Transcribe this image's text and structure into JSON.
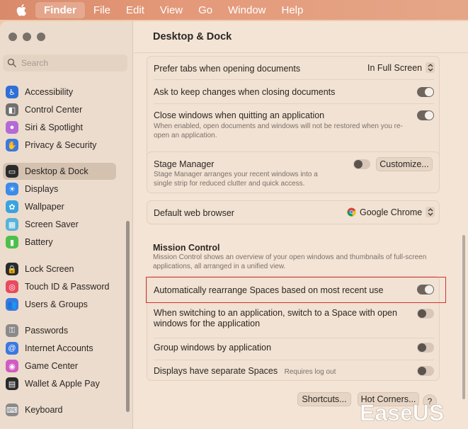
{
  "menubar": {
    "items": [
      "Finder",
      "File",
      "Edit",
      "View",
      "Go",
      "Window",
      "Help"
    ]
  },
  "sidebar": {
    "search_placeholder": "Search",
    "items": [
      {
        "label": "Accessibility",
        "icon": "accessibility-icon",
        "color": "#2f6fd6"
      },
      {
        "label": "Control Center",
        "icon": "control-center-icon",
        "color": "#707070"
      },
      {
        "label": "Siri & Spotlight",
        "icon": "siri-icon",
        "color": "#b46ad6"
      },
      {
        "label": "Privacy & Security",
        "icon": "hand-icon",
        "color": "#3b78e0"
      },
      {
        "label": "Desktop & Dock",
        "icon": "desktop-dock-icon",
        "color": "#2a2a2a"
      },
      {
        "label": "Displays",
        "icon": "displays-icon",
        "color": "#3a8bea"
      },
      {
        "label": "Wallpaper",
        "icon": "wallpaper-icon",
        "color": "#39a4e0"
      },
      {
        "label": "Screen Saver",
        "icon": "screen-saver-icon",
        "color": "#56b3d8"
      },
      {
        "label": "Battery",
        "icon": "battery-icon",
        "color": "#4cc04a"
      },
      {
        "label": "Lock Screen",
        "icon": "lock-icon",
        "color": "#2a2a2a"
      },
      {
        "label": "Touch ID & Password",
        "icon": "fingerprint-icon",
        "color": "#e84a5f"
      },
      {
        "label": "Users & Groups",
        "icon": "users-icon",
        "color": "#3b78e0"
      },
      {
        "label": "Passwords",
        "icon": "key-icon",
        "color": "#8a8a8a"
      },
      {
        "label": "Internet Accounts",
        "icon": "at-icon",
        "color": "#3b78e0"
      },
      {
        "label": "Game Center",
        "icon": "game-center-icon",
        "color": "#d05bc2"
      },
      {
        "label": "Wallet & Apple Pay",
        "icon": "wallet-icon",
        "color": "#2a2a2a"
      },
      {
        "label": "Keyboard",
        "icon": "keyboard-icon",
        "color": "#8a8a8a"
      }
    ],
    "active_index": 4
  },
  "main": {
    "title": "Desktop & Dock",
    "prefer_tabs": {
      "label": "Prefer tabs when opening documents",
      "value": "In Full Screen"
    },
    "ask_keep": {
      "label": "Ask to keep changes when closing documents"
    },
    "close_windows": {
      "label": "Close windows when quitting an application",
      "desc": "When enabled, open documents and windows will not be restored when you re-open an application."
    },
    "stage_manager": {
      "label": "Stage Manager",
      "desc": "Stage Manager arranges your recent windows into a single strip for reduced clutter and quick access.",
      "button": "Customize..."
    },
    "default_browser": {
      "label": "Default web browser",
      "value": "Google Chrome"
    },
    "mission_control": {
      "heading": "Mission Control",
      "desc": "Mission Control shows an overview of your open windows and thumbnails of full-screen applications, all arranged in a unified view."
    },
    "auto_rearrange": {
      "label": "Automatically rearrange Spaces based on most recent use"
    },
    "switch_space": {
      "label": "When switching to an application, switch to a Space with open windows for the application"
    },
    "group_windows": {
      "label": "Group windows by application"
    },
    "separate_spaces": {
      "label": "Displays have separate Spaces",
      "note": "Requires log out"
    },
    "shortcuts_button": "Shortcuts...",
    "hot_corners_button": "Hot Corners...",
    "help_label": "?"
  },
  "watermark": {
    "text": "EaseUS"
  },
  "colors": {
    "highlight": "#d5312f",
    "toggle_on": "#6d655e"
  }
}
